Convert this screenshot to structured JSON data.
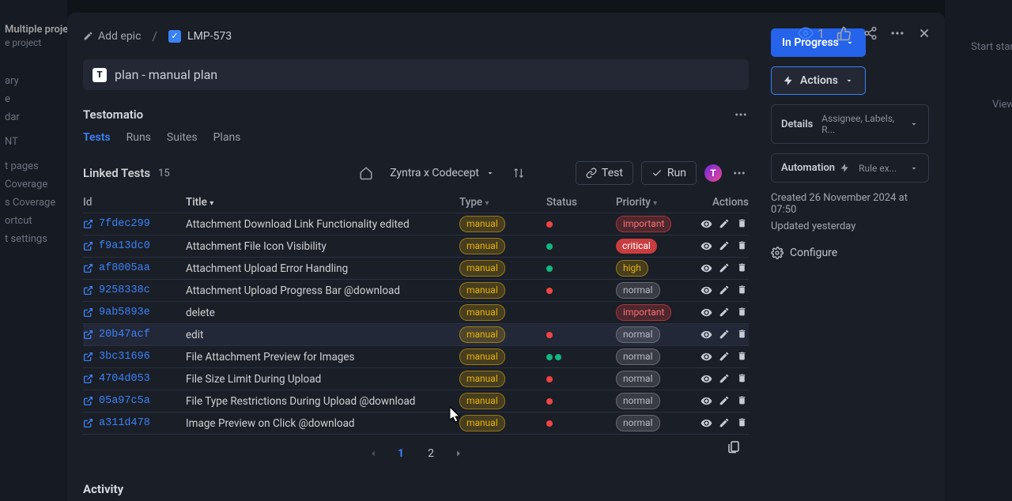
{
  "bg": {
    "proj_title": "Multiple projects",
    "proj_sub": "e project",
    "items": [
      "ary",
      "e",
      "dar",
      "",
      "NT",
      "",
      "t pages",
      "Coverage",
      "s Coverage",
      "ortcut",
      "t settings"
    ],
    "right1": "Start stand-up",
    "right2": "View se"
  },
  "breadcrumb": {
    "add_epic": "Add epic",
    "ticket": "LMP-573"
  },
  "watch_count": "1",
  "title_bar": "plan - manual plan",
  "sections": {
    "testomatio": "Testomatio",
    "linked_tests": "Linked Tests",
    "linked_count": "15",
    "activity": "Activity"
  },
  "tabs": [
    "Tests",
    "Runs",
    "Suites",
    "Plans"
  ],
  "active_tab": 0,
  "project_selector": "Zyntra x Codecept",
  "buttons": {
    "test": "Test",
    "run": "Run"
  },
  "columns": {
    "id": "Id",
    "title": "Title",
    "type": "Type",
    "status": "Status",
    "priority": "Priority",
    "actions": "Actions"
  },
  "rows": [
    {
      "id": "7fdec299",
      "title": "Attachment Download Link Functionality edited",
      "type": "manual",
      "status": [
        "red"
      ],
      "priority": "important"
    },
    {
      "id": "f9a13dc0",
      "title": "Attachment File Icon Visibility",
      "type": "manual",
      "status": [
        "green"
      ],
      "priority": "critical"
    },
    {
      "id": "af8005aa",
      "title": "Attachment Upload Error Handling",
      "type": "manual",
      "status": [
        "green"
      ],
      "priority": "high"
    },
    {
      "id": "9258338c",
      "title": "Attachment Upload Progress Bar @download",
      "type": "manual",
      "status": [
        "red"
      ],
      "priority": "normal"
    },
    {
      "id": "9ab5893e",
      "title": "delete",
      "type": "manual",
      "status": [],
      "priority": "important"
    },
    {
      "id": "20b47acf",
      "title": "edit",
      "type": "manual",
      "status": [
        "red"
      ],
      "priority": "normal",
      "hover": true
    },
    {
      "id": "3bc31696",
      "title": "File Attachment Preview for Images",
      "type": "manual",
      "status": [
        "green",
        "green"
      ],
      "priority": "normal"
    },
    {
      "id": "4704d053",
      "title": "File Size Limit During Upload",
      "type": "manual",
      "status": [
        "red"
      ],
      "priority": "normal"
    },
    {
      "id": "05a97c5a",
      "title": "File Type Restrictions During Upload @download",
      "type": "manual",
      "status": [
        "red"
      ],
      "priority": "normal"
    },
    {
      "id": "a311d478",
      "title": "Image Preview on Click @download",
      "type": "manual",
      "status": [
        "red"
      ],
      "priority": "normal"
    }
  ],
  "pagination": {
    "current": "1",
    "other": "2"
  },
  "side": {
    "status": "In Progress",
    "actions": "Actions",
    "details_title": "Details",
    "details_sub": "Assignee, Labels, R...",
    "automation_title": "Automation",
    "automation_sub": "Rule ex...",
    "created": "Created 26 November 2024 at 07:50",
    "updated": "Updated yesterday",
    "configure": "Configure"
  }
}
